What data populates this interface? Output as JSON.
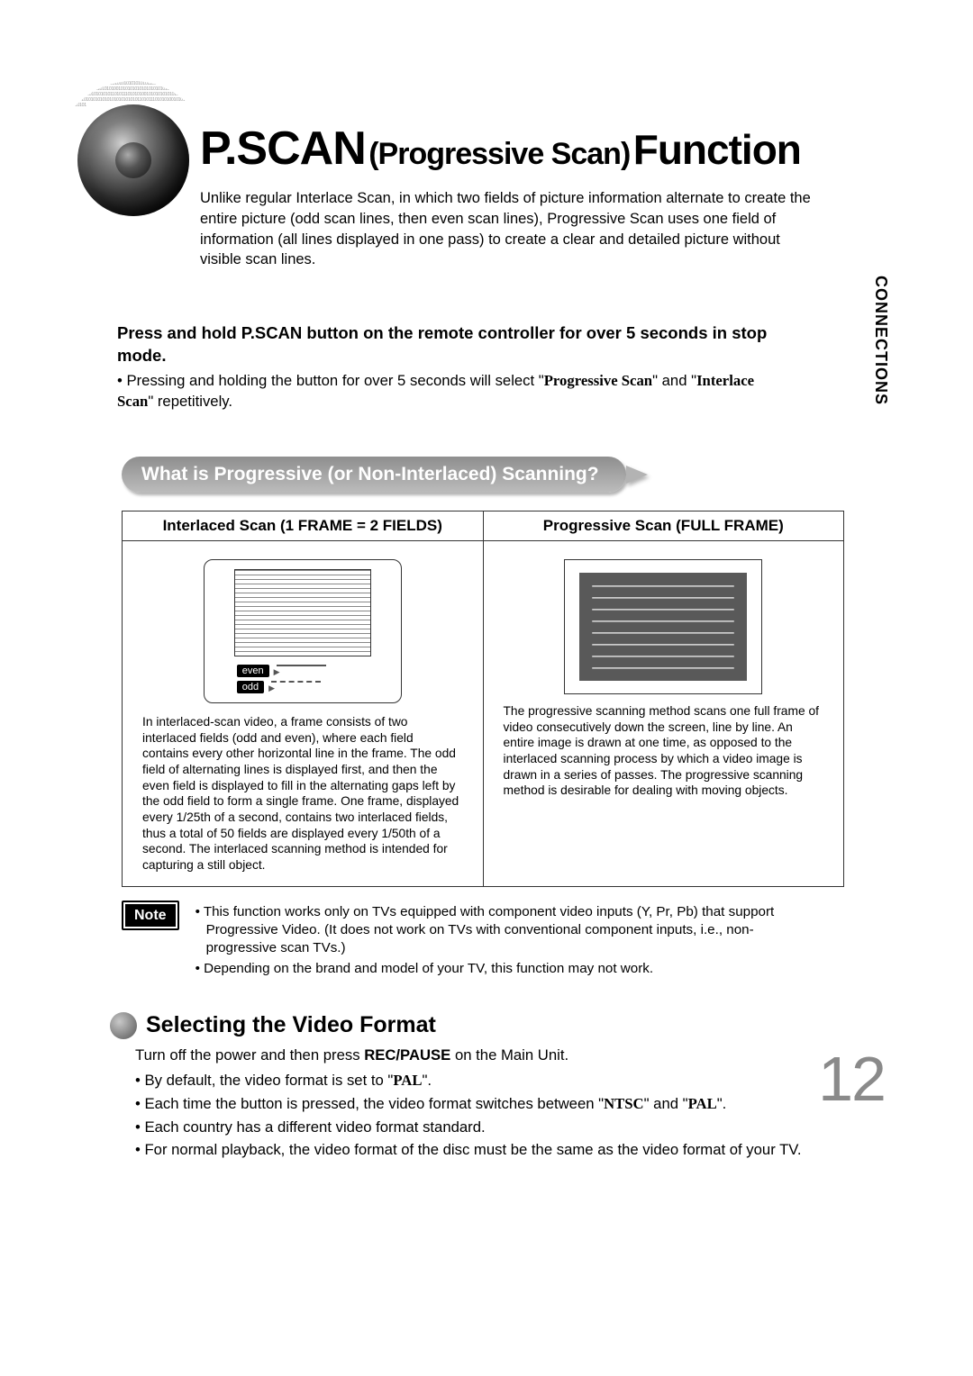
{
  "sideTab": "CONNECTIONS",
  "title": {
    "part1": "P.SCAN",
    "part2": "(Progressive Scan)",
    "part3": "Function"
  },
  "intro": "Unlike regular Interlace Scan, in which two fields of picture information alternate to create the entire picture (odd scan lines, then even scan lines), Progressive Scan uses one field of information (all lines displayed in one pass) to create a clear and detailed picture without visible scan lines.",
  "instruction": {
    "lead": "Press and hold P.SCAN button on the remote controller for over 5 seconds in stop mode.",
    "bullet_pre": "Pressing and holding the button for over 5 seconds will select \"",
    "opt1": "Progressive Scan",
    "mid": "\" and \"",
    "opt2": "Interlace Scan",
    "bullet_post": "\" repetitively."
  },
  "callout": "What is Progressive (or Non-Interlaced) Scanning?",
  "table": {
    "head_left": "Interlaced Scan (1 FRAME = 2 FIELDS)",
    "head_right": "Progressive Scan (FULL FRAME)",
    "legend_even": "even",
    "legend_odd": "odd",
    "desc_left": "In interlaced-scan video, a frame consists of two interlaced fields (odd and even), where each field contains every other horizontal line in the frame. The odd field of alternating lines is displayed first, and then the even field is displayed to fill in the alternating gaps left by the odd field to form a single frame. One frame, displayed every 1/25th of a second, contains two interlaced fields, thus a total of 50 fields are displayed every 1/50th of a second. The interlaced scanning method is intended for capturing a still object.",
    "desc_right": "The progressive scanning method scans one full frame of video consecutively down the screen, line by line. An entire image is drawn at one time, as opposed to the interlaced scanning process by which a video image is drawn in a series of passes. The progressive scanning method is desirable for dealing with moving objects."
  },
  "noteLabel": "Note",
  "notes": [
    "This function works only on TVs equipped with component video inputs (Y, Pr, Pb) that support Progressive Video. (It does not work on TVs with conventional component inputs, i.e., non-progressive scan TVs.)",
    "Depending on the brand and model of your TV, this function may not work."
  ],
  "selecting": {
    "heading": "Selecting the Video Format",
    "intro_pre": "Turn off the power and then press ",
    "intro_bold": "REC/PAUSE",
    "intro_post": " on the Main Unit.",
    "b1_pre": "By default, the video format is set to \"",
    "b1_val": "PAL",
    "b1_post": "\".",
    "b2_pre": "Each time the button is pressed, the video format switches between \"",
    "b2_v1": "NTSC",
    "b2_mid": "\" and \"",
    "b2_v2": "PAL",
    "b2_post": "\".",
    "b3": "Each country has a different video format standard.",
    "b4": "For normal playback, the video format of the disc must be the same as the video format of your TV."
  },
  "pageNumber": "12",
  "decor_bits": "0101010101010100101010101010101010101010110101110101010010101010101010101010101011010111010101001010101010101010101010101101011101010100101010101010101010101010110101110101010010101010101010101010101011010111010101001010101010101010101010101101011101010100101010101010101010101010110101"
}
